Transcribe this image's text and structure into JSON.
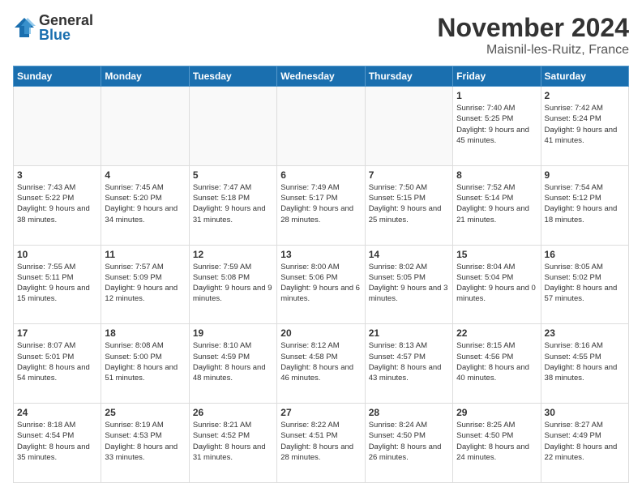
{
  "logo": {
    "general": "General",
    "blue": "Blue"
  },
  "title": "November 2024",
  "location": "Maisnil-les-Ruitz, France",
  "days_header": [
    "Sunday",
    "Monday",
    "Tuesday",
    "Wednesday",
    "Thursday",
    "Friday",
    "Saturday"
  ],
  "weeks": [
    [
      {
        "day": "",
        "info": ""
      },
      {
        "day": "",
        "info": ""
      },
      {
        "day": "",
        "info": ""
      },
      {
        "day": "",
        "info": ""
      },
      {
        "day": "",
        "info": ""
      },
      {
        "day": "1",
        "info": "Sunrise: 7:40 AM\nSunset: 5:25 PM\nDaylight: 9 hours and 45 minutes."
      },
      {
        "day": "2",
        "info": "Sunrise: 7:42 AM\nSunset: 5:24 PM\nDaylight: 9 hours and 41 minutes."
      }
    ],
    [
      {
        "day": "3",
        "info": "Sunrise: 7:43 AM\nSunset: 5:22 PM\nDaylight: 9 hours and 38 minutes."
      },
      {
        "day": "4",
        "info": "Sunrise: 7:45 AM\nSunset: 5:20 PM\nDaylight: 9 hours and 34 minutes."
      },
      {
        "day": "5",
        "info": "Sunrise: 7:47 AM\nSunset: 5:18 PM\nDaylight: 9 hours and 31 minutes."
      },
      {
        "day": "6",
        "info": "Sunrise: 7:49 AM\nSunset: 5:17 PM\nDaylight: 9 hours and 28 minutes."
      },
      {
        "day": "7",
        "info": "Sunrise: 7:50 AM\nSunset: 5:15 PM\nDaylight: 9 hours and 25 minutes."
      },
      {
        "day": "8",
        "info": "Sunrise: 7:52 AM\nSunset: 5:14 PM\nDaylight: 9 hours and 21 minutes."
      },
      {
        "day": "9",
        "info": "Sunrise: 7:54 AM\nSunset: 5:12 PM\nDaylight: 9 hours and 18 minutes."
      }
    ],
    [
      {
        "day": "10",
        "info": "Sunrise: 7:55 AM\nSunset: 5:11 PM\nDaylight: 9 hours and 15 minutes."
      },
      {
        "day": "11",
        "info": "Sunrise: 7:57 AM\nSunset: 5:09 PM\nDaylight: 9 hours and 12 minutes."
      },
      {
        "day": "12",
        "info": "Sunrise: 7:59 AM\nSunset: 5:08 PM\nDaylight: 9 hours and 9 minutes."
      },
      {
        "day": "13",
        "info": "Sunrise: 8:00 AM\nSunset: 5:06 PM\nDaylight: 9 hours and 6 minutes."
      },
      {
        "day": "14",
        "info": "Sunrise: 8:02 AM\nSunset: 5:05 PM\nDaylight: 9 hours and 3 minutes."
      },
      {
        "day": "15",
        "info": "Sunrise: 8:04 AM\nSunset: 5:04 PM\nDaylight: 9 hours and 0 minutes."
      },
      {
        "day": "16",
        "info": "Sunrise: 8:05 AM\nSunset: 5:02 PM\nDaylight: 8 hours and 57 minutes."
      }
    ],
    [
      {
        "day": "17",
        "info": "Sunrise: 8:07 AM\nSunset: 5:01 PM\nDaylight: 8 hours and 54 minutes."
      },
      {
        "day": "18",
        "info": "Sunrise: 8:08 AM\nSunset: 5:00 PM\nDaylight: 8 hours and 51 minutes."
      },
      {
        "day": "19",
        "info": "Sunrise: 8:10 AM\nSunset: 4:59 PM\nDaylight: 8 hours and 48 minutes."
      },
      {
        "day": "20",
        "info": "Sunrise: 8:12 AM\nSunset: 4:58 PM\nDaylight: 8 hours and 46 minutes."
      },
      {
        "day": "21",
        "info": "Sunrise: 8:13 AM\nSunset: 4:57 PM\nDaylight: 8 hours and 43 minutes."
      },
      {
        "day": "22",
        "info": "Sunrise: 8:15 AM\nSunset: 4:56 PM\nDaylight: 8 hours and 40 minutes."
      },
      {
        "day": "23",
        "info": "Sunrise: 8:16 AM\nSunset: 4:55 PM\nDaylight: 8 hours and 38 minutes."
      }
    ],
    [
      {
        "day": "24",
        "info": "Sunrise: 8:18 AM\nSunset: 4:54 PM\nDaylight: 8 hours and 35 minutes."
      },
      {
        "day": "25",
        "info": "Sunrise: 8:19 AM\nSunset: 4:53 PM\nDaylight: 8 hours and 33 minutes."
      },
      {
        "day": "26",
        "info": "Sunrise: 8:21 AM\nSunset: 4:52 PM\nDaylight: 8 hours and 31 minutes."
      },
      {
        "day": "27",
        "info": "Sunrise: 8:22 AM\nSunset: 4:51 PM\nDaylight: 8 hours and 28 minutes."
      },
      {
        "day": "28",
        "info": "Sunrise: 8:24 AM\nSunset: 4:50 PM\nDaylight: 8 hours and 26 minutes."
      },
      {
        "day": "29",
        "info": "Sunrise: 8:25 AM\nSunset: 4:50 PM\nDaylight: 8 hours and 24 minutes."
      },
      {
        "day": "30",
        "info": "Sunrise: 8:27 AM\nSunset: 4:49 PM\nDaylight: 8 hours and 22 minutes."
      }
    ]
  ]
}
